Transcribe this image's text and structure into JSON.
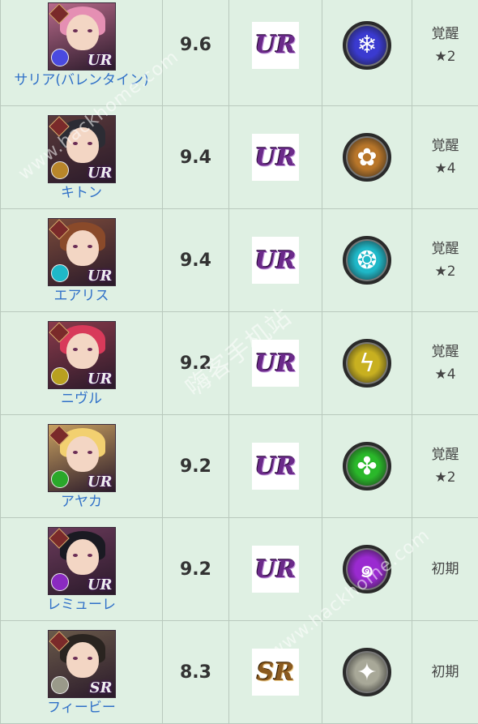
{
  "rows": [
    {
      "name": "サリア(バレンタイン)",
      "score": "9.6",
      "rarity": "UR",
      "attr_icon": "snowflake-icon",
      "attr_color": "#3a3ad0",
      "status_line1": "覚醒",
      "status_line2": "★2",
      "hair": "#e58fb3",
      "bg": "#b86a8a",
      "elem_color": "#4a4ae0",
      "glyph": "❄"
    },
    {
      "name": "キトン",
      "score": "9.4",
      "rarity": "UR",
      "attr_icon": "honeycomb-icon",
      "attr_color": "#b8762a",
      "status_line1": "覚醒",
      "status_line2": "★4",
      "hair": "#2c2c34",
      "bg": "#5a3a3a",
      "elem_color": "#b8862a",
      "glyph": "✿"
    },
    {
      "name": "エアリス",
      "score": "9.4",
      "rarity": "UR",
      "attr_icon": "water-swirl-icon",
      "attr_color": "#1fb8c8",
      "status_line1": "覚醒",
      "status_line2": "★2",
      "hair": "#8a4a2a",
      "bg": "#7a4a3a",
      "elem_color": "#1fb8c8",
      "glyph": "❂"
    },
    {
      "name": "ニヴル",
      "score": "9.2",
      "rarity": "UR",
      "attr_icon": "lightning-icon",
      "attr_color": "#c8b020",
      "status_line1": "覚醒",
      "status_line2": "★4",
      "hair": "#d83a5a",
      "bg": "#8a3a4a",
      "elem_color": "#b8a020",
      "glyph": "ϟ"
    },
    {
      "name": "アヤカ",
      "score": "9.2",
      "rarity": "UR",
      "attr_icon": "wind-pinwheel-icon",
      "attr_color": "#2ab82a",
      "status_line1": "覚醒",
      "status_line2": "★2",
      "hair": "#f2d070",
      "bg": "#c8a060",
      "elem_color": "#2aa82a",
      "glyph": "✤"
    },
    {
      "name": "レミューレ",
      "score": "9.2",
      "rarity": "UR",
      "attr_icon": "dark-vortex-icon",
      "attr_color": "#9a2ad0",
      "status_line1": "初期",
      "status_line2": "",
      "hair": "#1a1a22",
      "bg": "#6a3a5a",
      "elem_color": "#8a2ac0",
      "glyph": "๑"
    },
    {
      "name": "フィービー",
      "score": "8.3",
      "rarity": "SR",
      "attr_icon": "light-cross-icon",
      "attr_color": "#a8a898",
      "status_line1": "初期",
      "status_line2": "",
      "hair": "#2a2420",
      "bg": "#6a5a4a",
      "elem_color": "#9a9a8a",
      "glyph": "✦"
    }
  ],
  "watermarks": {
    "a": "www.hackhome.com",
    "b": "嗨客手机站",
    "c": "www.hackhome.com"
  }
}
